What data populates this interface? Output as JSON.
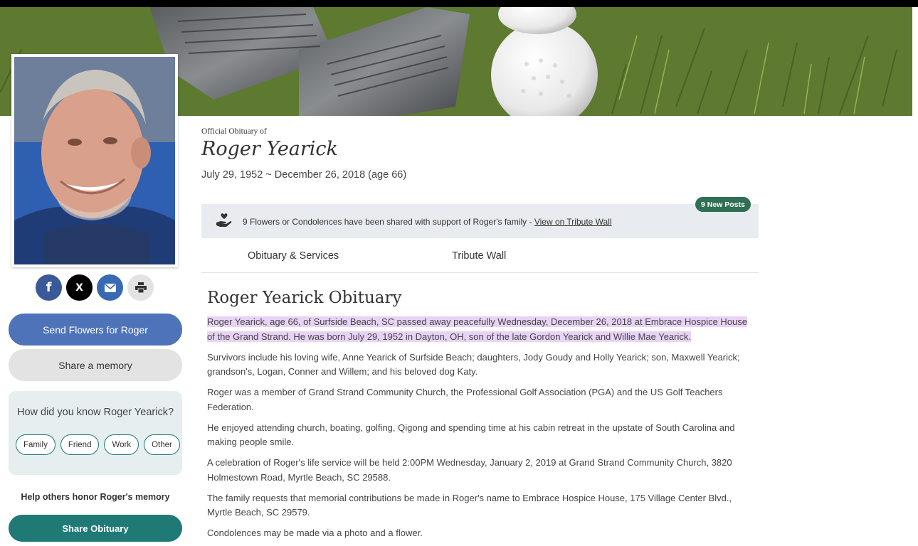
{
  "banner": {
    "image": "golf clubs and golf balls on grass"
  },
  "photo": {
    "alt": "Roger Yearick"
  },
  "social": {
    "icons": [
      "facebook-icon",
      "x-icon",
      "email-icon",
      "print-icon"
    ],
    "fb_glyph": "f",
    "x_glyph": "X"
  },
  "sidebar": {
    "send_flowers": "Send Flowers for Roger",
    "share_memory": "Share a memory",
    "know_title": "How did you know Roger Yearick?",
    "chips": [
      "Family",
      "Friend",
      "Work",
      "Other"
    ],
    "help_text": "Help others honor Roger's memory",
    "share_obituary": "Share Obituary"
  },
  "header": {
    "official": "Official Obituary of",
    "name": "Roger Yearick",
    "dates": "July 29, 1952 ~ December 26, 2018 (age 66)"
  },
  "tribute": {
    "text": "9 Flowers or Condolences have been shared with support of Roger's family - ",
    "link": "View on Tribute Wall",
    "new_posts": "9 New Posts"
  },
  "tabs": [
    "Obituary & Services",
    "Tribute Wall"
  ],
  "obituary": {
    "heading": "Roger Yearick Obituary",
    "highlighted": "Roger Yearick, age 66, of Surfside Beach, SC passed away peacefully Wednesday, December 26, 2018 at Embrace Hospice House of the Grand Strand. He was born July 29, 1952 in Dayton, OH, son of the late Gordon Yearick and Willie Mae Yearick.",
    "paragraphs": [
      "Survivors include his loving wife, Anne Yearick of Surfside Beach; daughters, Jody Goudy and Holly Yearick; son, Maxwell Yearick; grandson's, Logan, Conner and Willem; and his beloved dog Katy.",
      "Roger was a member of Grand Strand Community Church, the Professional Golf Association (PGA) and the US Golf Teachers Federation.",
      "He enjoyed attending church, boating, golfing, Qigong and spending time at his cabin retreat in the upstate of South Carolina and making people smile.",
      "A celebration of Roger's life service will be held 2:00PM Wednesday, January 2, 2019 at Grand Strand Community Church, 3820 Holmestown Road, Myrtle Beach, SC 29588.",
      "The family requests that memorial contributions be made in Roger's name to Embrace Hospice House, 175 Village Center Blvd., Myrtle Beach, SC 29579.",
      "Condolences may be made via a photo and a flower."
    ]
  },
  "colors": {
    "primary_blue": "#4e73b8",
    "teal": "#1f7a75",
    "highlight": "#e9d3f5",
    "new_posts_green": "#2f6f54"
  }
}
